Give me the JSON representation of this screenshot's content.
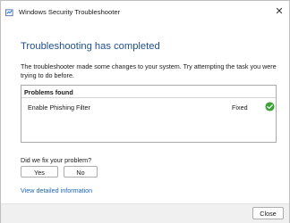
{
  "window": {
    "title": "Windows Security Troubleshooter",
    "app_icon": "troubleshooter-icon",
    "close_glyph": "✕"
  },
  "main": {
    "heading": "Troubleshooting has completed",
    "description": "The troubleshooter made some changes to your system. Try attempting the task you were trying to do before."
  },
  "problems": {
    "header": "Problems found",
    "items": [
      {
        "name": "Enable Phishing Filter",
        "status": "Fixed",
        "icon": "check-icon"
      }
    ]
  },
  "feedback": {
    "question": "Did we fix your problem?",
    "yes_label": "Yes",
    "no_label": "No"
  },
  "details_link": "View detailed information",
  "footer": {
    "close_label": "Close"
  },
  "colors": {
    "heading": "#1f4e8f",
    "link": "#1e66b3",
    "success": "#3aa335"
  }
}
